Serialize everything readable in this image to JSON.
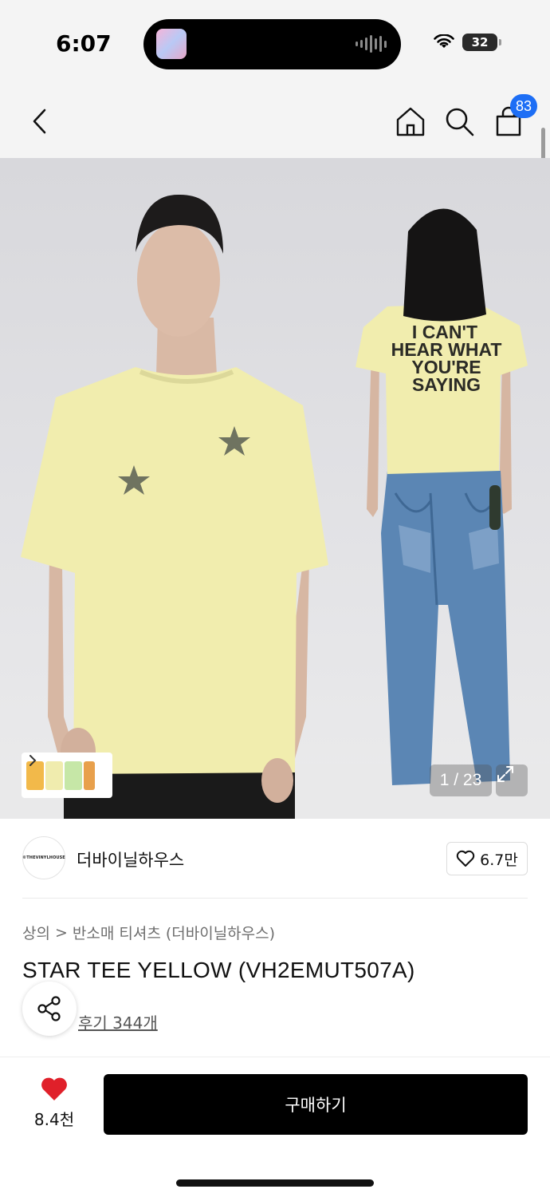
{
  "status_bar": {
    "time": "6:07",
    "battery": "32"
  },
  "nav": {
    "cart_count": "83"
  },
  "hero": {
    "back_print": [
      "I CAN'T",
      "HEAR WHAT",
      "YOU'RE",
      "SAYING"
    ],
    "counter": "1 / 23"
  },
  "brand": {
    "logo_text": "©THEVINYLHOUSE",
    "name": "더바이닐하우스",
    "likes": "6.7만"
  },
  "breadcrumb": {
    "level1": "상의",
    "separator": ">",
    "level2": "반소매 티셔츠 (더바이닐하우스)"
  },
  "product": {
    "title": "STAR TEE YELLOW (VH2EMUT507A)"
  },
  "reviews": {
    "label": "후기 344개"
  },
  "bottom": {
    "wish_count": "8.4천",
    "buy_label": "구매하기"
  },
  "colors": {
    "accent_blue": "#1d6ef5",
    "heart_red": "#e0202a",
    "shirt_yellow": "#f0ecae",
    "denim": "#5b86b4"
  }
}
